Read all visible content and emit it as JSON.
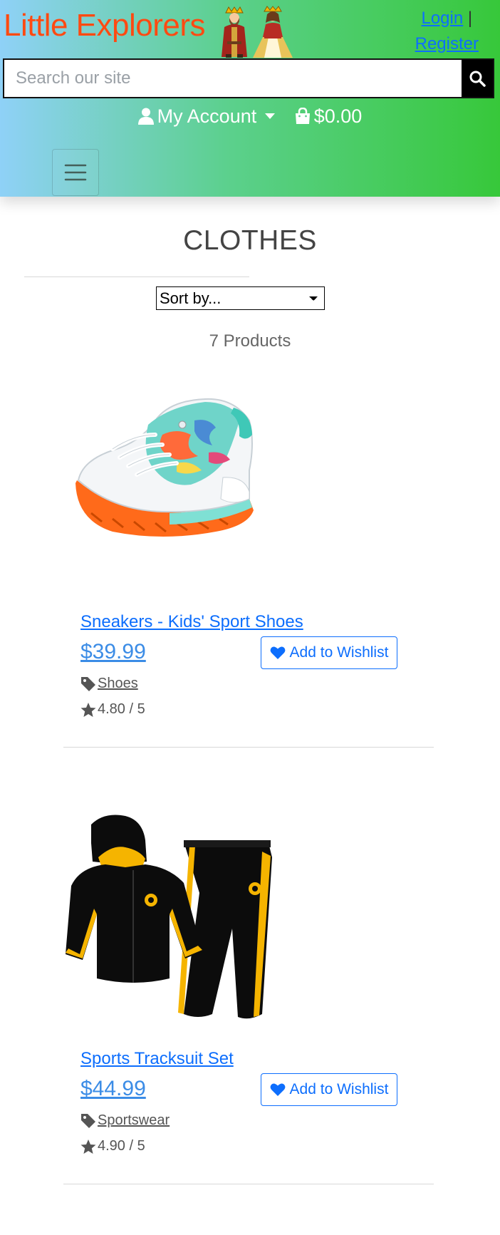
{
  "header": {
    "logo": "Little Explorers",
    "login": "Login",
    "separator": "|",
    "register": "Register",
    "search_placeholder": "Search our site",
    "account_label": "My Account",
    "cart_total": "$0.00",
    "colors": {
      "logo": "#ff4a12",
      "gradient_start": "#8fd1f7",
      "gradient_end": "#37c83a"
    }
  },
  "main": {
    "title": "CLOTHES",
    "sort_placeholder": "Sort by...",
    "product_count": "7 Products"
  },
  "products": [
    {
      "name": "Sneakers - Kids' Sport Shoes",
      "price": "$39.99",
      "wishlist_label": "Add to Wishlist",
      "category": "Shoes",
      "rating": "4.80 / 5",
      "image": "sneaker-image"
    },
    {
      "name": "Sports Tracksuit Set",
      "price": "$44.99",
      "wishlist_label": "Add to Wishlist",
      "category": "Sportswear",
      "rating": "4.90 / 5",
      "image": "tracksuit-image"
    }
  ]
}
